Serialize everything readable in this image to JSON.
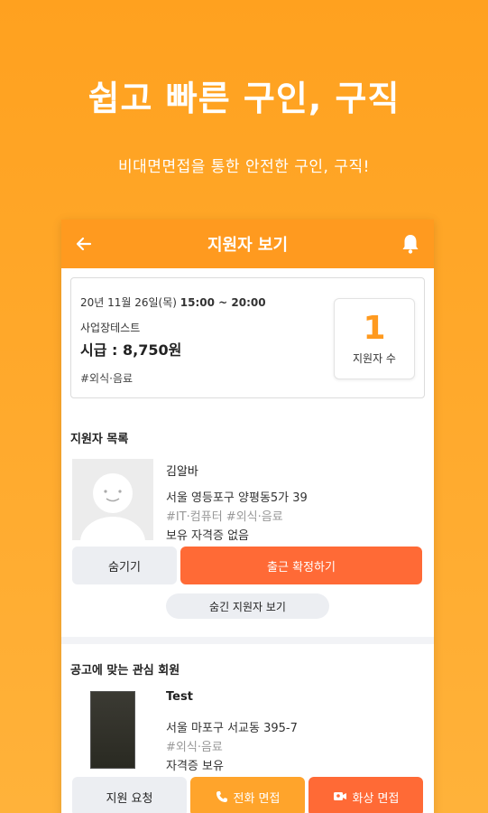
{
  "hero": {
    "title": "쉽고 빠른 구인, 구직",
    "subtitle": "비대면면접을 통한 안전한 구인, 구직!"
  },
  "appbar": {
    "title": "지원자 보기",
    "back_icon": "arrow-left-icon",
    "bell_icon": "bell-icon"
  },
  "job": {
    "date": "20년 11월 26일(목)",
    "time": "15:00 ~ 20:00",
    "company": "사업장테스트",
    "wage": "시급 : 8,750원",
    "tag": "#외식·음료",
    "applicant_count": "1",
    "applicant_count_label": "지원자 수"
  },
  "applicants": {
    "section_title": "지원자 목록",
    "items": [
      {
        "name": "김알바",
        "address": "서울 영등포구 양평동5가 39",
        "tags": "#IT·컴퓨터 #외식·음료",
        "license": "보유 자격증 없음"
      }
    ],
    "hide_button": "숨기기",
    "confirm_button": "출근 확정하기",
    "show_hidden_button": "숨긴 지원자 보기"
  },
  "members": {
    "section_title": "공고에 맞는 관심 회원",
    "items": [
      {
        "name": "Test",
        "address": "서울 마포구 서교동 395-7",
        "tags": "#외식·음료",
        "license": "자격증 보유"
      }
    ],
    "request_button": "지원 요청",
    "phone_button": "전화 면접",
    "video_button": "화상 면접"
  },
  "colors": {
    "background": "#ffa11f",
    "appbar": "#ff9a1f",
    "accent_orange": "#ff6a36",
    "accent_yellow": "#ffa42b"
  }
}
